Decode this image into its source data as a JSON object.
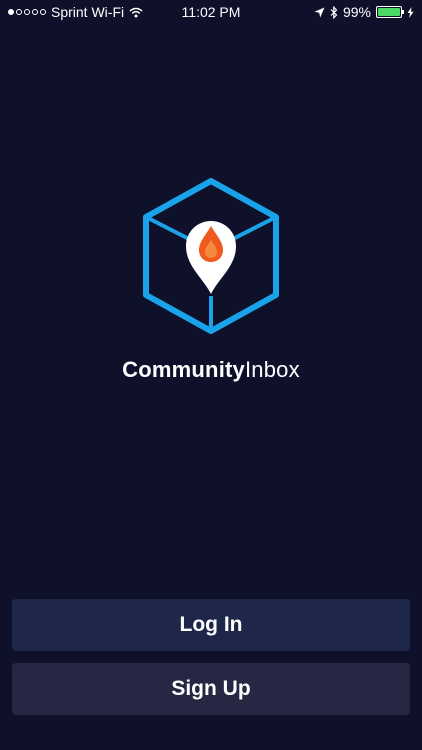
{
  "status_bar": {
    "carrier": "Sprint Wi-Fi",
    "time": "11:02 PM",
    "battery": "99%",
    "battery_level": 0.99
  },
  "brand": {
    "name_bold": "Community",
    "name_regular": "Inbox"
  },
  "buttons": {
    "login": "Log In",
    "signup": "Sign Up"
  },
  "colors": {
    "background": "#0f112b",
    "logo_blue": "#1aa3e8",
    "flame_orange": "#f05a1e",
    "login_button": "#1e2749",
    "signup_button": "#262843",
    "battery_green": "#4cd964"
  },
  "icons": {
    "logo": "cube-location-pin-flame-icon",
    "wifi": "wifi-icon",
    "location": "location-arrow-icon",
    "bluetooth": "bluetooth-icon",
    "charging": "charging-bolt-icon"
  }
}
